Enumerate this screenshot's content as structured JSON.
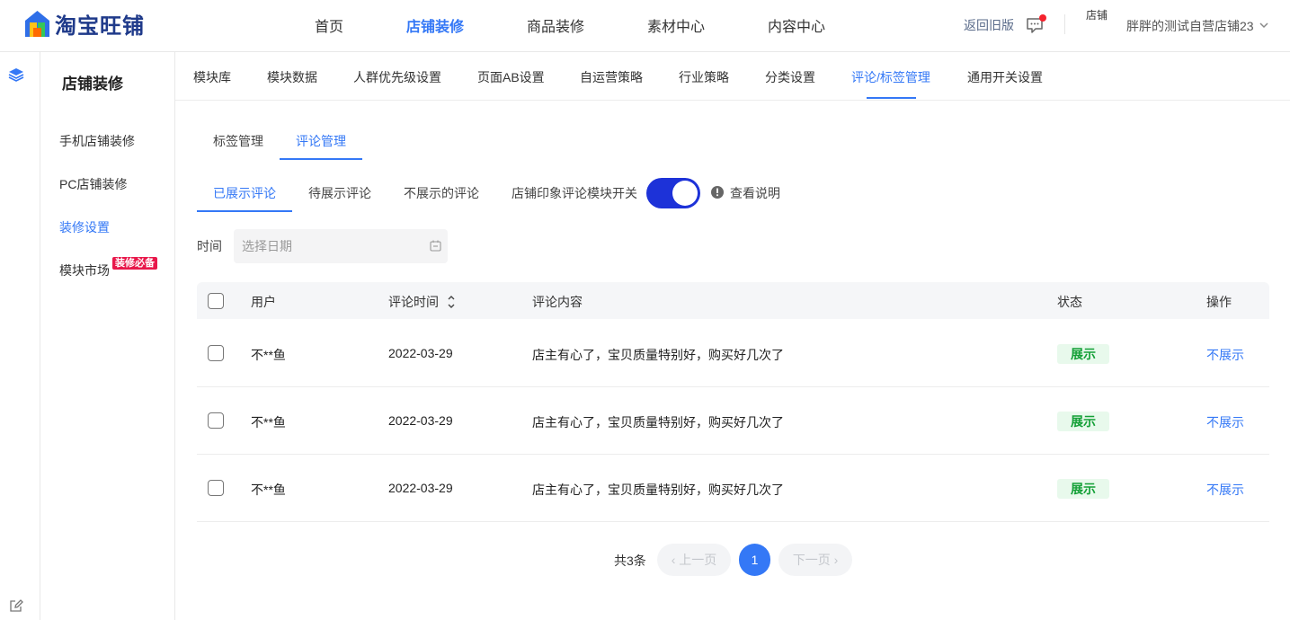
{
  "brand": {
    "logo_text": "淘宝旺铺"
  },
  "topnav": {
    "items": [
      "首页",
      "店铺装修",
      "商品装修",
      "素材中心",
      "内容中心"
    ],
    "active_index": 1
  },
  "header_right": {
    "back_old": "返回旧版",
    "avatar_alt": "店铺",
    "shop_name": "胖胖的测试自营店铺23"
  },
  "sidebar": {
    "title": "店铺装修",
    "items": [
      "手机店铺装修",
      "PC店铺装修",
      "装修设置",
      "模块市场"
    ],
    "active_index": 2,
    "badge": "装修必备"
  },
  "subnav": {
    "items": [
      "模块库",
      "模块数据",
      "人群优先级设置",
      "页面AB设置",
      "自运营策略",
      "行业策略",
      "分类设置",
      "评论/标签管理",
      "通用开关设置"
    ],
    "active_index": 7
  },
  "tabs2": {
    "items": [
      "标签管理",
      "评论管理"
    ],
    "active_index": 1
  },
  "tabs3": {
    "items": [
      "已展示评论",
      "待展示评论",
      "不展示的评论"
    ],
    "active_index": 0,
    "toggle_label": "店铺印象评论模块开关",
    "toggle_on": true,
    "view_desc": "查看说明"
  },
  "filter": {
    "label": "时间",
    "placeholder": "选择日期"
  },
  "table": {
    "columns": [
      "用户",
      "评论时间",
      "评论内容",
      "状态",
      "操作"
    ],
    "rows": [
      {
        "user": "不**鱼",
        "time": "2022-03-29",
        "content": "店主有心了，宝贝质量特别好，购买好几次了",
        "status": "展示",
        "action": "不展示"
      },
      {
        "user": "不**鱼",
        "time": "2022-03-29",
        "content": "店主有心了，宝贝质量特别好，购买好几次了",
        "status": "展示",
        "action": "不展示"
      },
      {
        "user": "不**鱼",
        "time": "2022-03-29",
        "content": "店主有心了，宝贝质量特别好，购买好几次了",
        "status": "展示",
        "action": "不展示"
      }
    ]
  },
  "pagination": {
    "total": "共3条",
    "prev": "上一页",
    "current": "1",
    "next": "下一页"
  },
  "colors": {
    "accent": "#3478f6",
    "toggle": "#1d32d8",
    "badge": "#e8174a",
    "status_green": "#14a037"
  }
}
